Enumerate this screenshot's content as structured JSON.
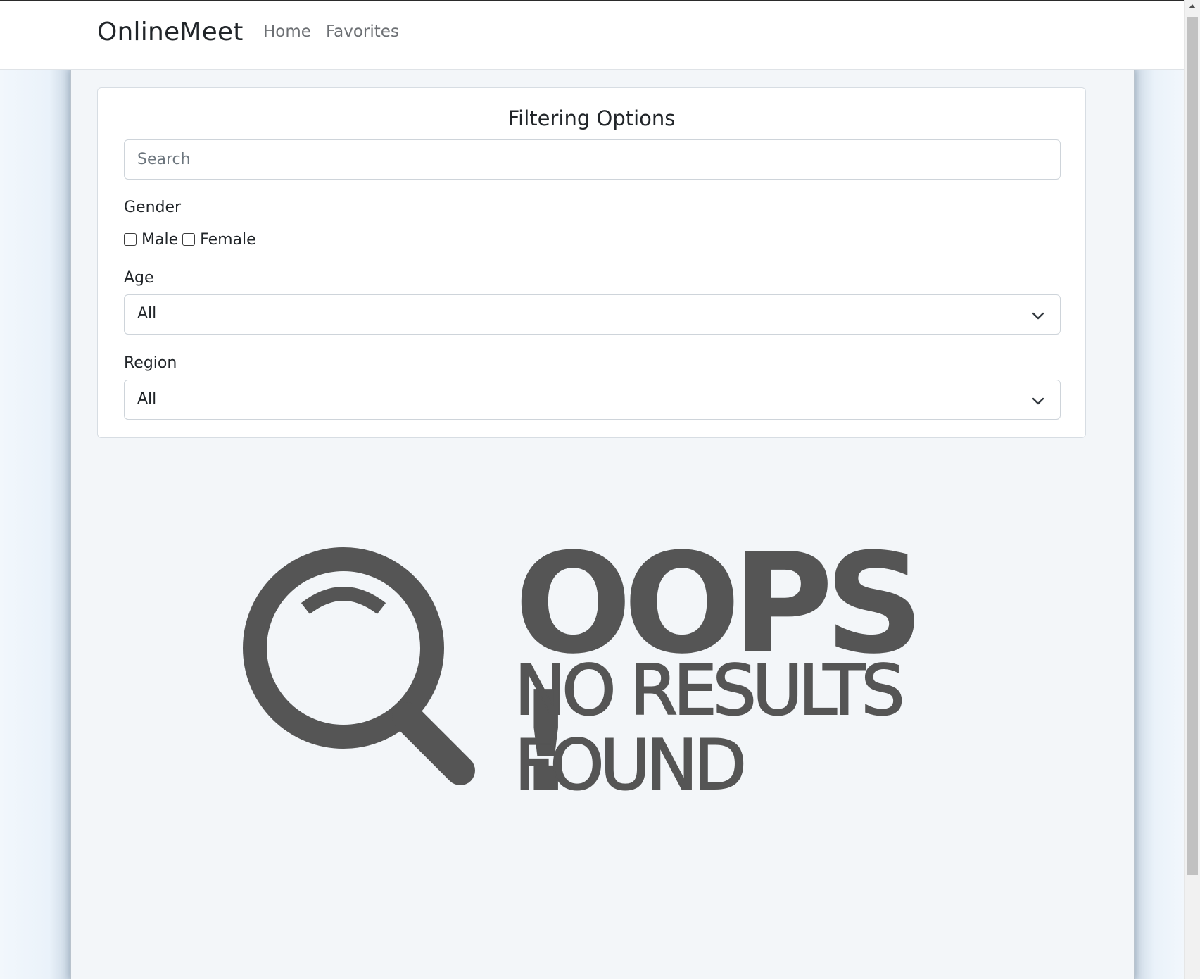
{
  "navbar": {
    "brand": "OnlineMeet",
    "links": [
      "Home",
      "Favorites"
    ]
  },
  "filters": {
    "title": "Filtering Options",
    "search_placeholder": "Search",
    "search_value": "",
    "gender_label": "Gender",
    "gender_options": [
      "Male",
      "Female"
    ],
    "age_label": "Age",
    "age_value": "All",
    "region_label": "Region",
    "region_value": "All"
  },
  "empty_state": {
    "headline": "OOPS !",
    "line1": "NO RESULTS",
    "line2": "FOUND",
    "icon": "magnifier-icon"
  },
  "colors": {
    "illustration": "#555555",
    "page_bg": "#f3f6f9"
  }
}
